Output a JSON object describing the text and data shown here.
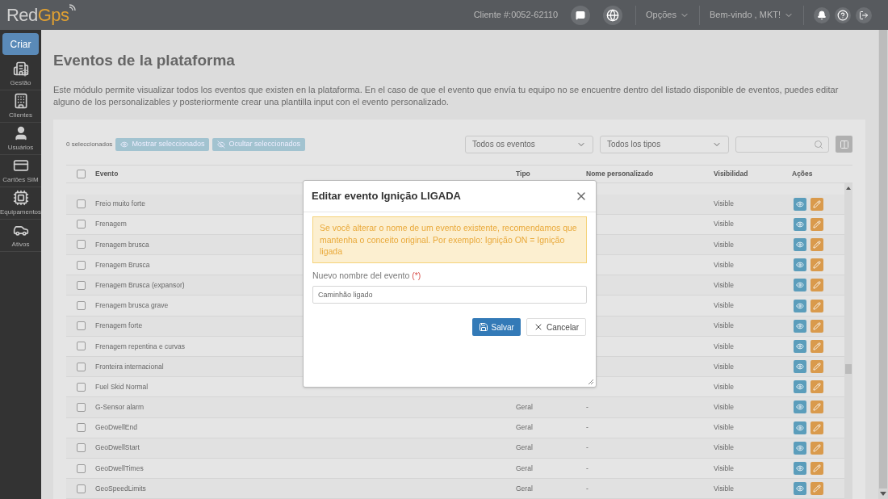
{
  "topbar": {
    "logo": {
      "first": "Red",
      "second": "Gps"
    },
    "client": "Cliente #:0052-62110",
    "options_menu": "Opções",
    "welcome_menu": "Bem-vindo , MKT!"
  },
  "sidebar": {
    "create_button": "Criar",
    "items": [
      {
        "kind": "gestao",
        "label": "Gestão"
      },
      {
        "kind": "clientes",
        "label": "Clientes"
      },
      {
        "kind": "usuarios",
        "label": "Usuários"
      },
      {
        "kind": "sim",
        "label": "Cartões SIM"
      },
      {
        "kind": "equip",
        "label": "Equipamentos"
      },
      {
        "kind": "ativos",
        "label": "Ativos"
      }
    ]
  },
  "page": {
    "title": "Eventos de la plataforma",
    "description": "Este módulo permite visualizar todos los eventos que existen en la plataforma. En el caso de que el evento que envía tu equipo no se encuentre dentro del listado disponible de eventos, puedes editar alguno de los personalizables y posteriormente crear una plantilla input con el evento personalizado."
  },
  "toolbar": {
    "selected_count": "0 seleccionados",
    "show_button": "Mostrar seleccionados",
    "hide_button": "Ocultar seleccionados",
    "event_filter": "Todos os eventos",
    "type_filter": "Todos los tipos"
  },
  "table": {
    "select_all": {
      "checked": false
    },
    "columns": [
      "Evento",
      "Tipo",
      "Nome personalizado",
      "Visibilidad",
      "Ações"
    ],
    "rows": [
      {
        "checked": false,
        "event": "Freio muito forte",
        "visibility": "Visible"
      },
      {
        "checked": false,
        "event": "Frenagem",
        "visibility": "Visible"
      },
      {
        "checked": false,
        "event": "Frenagem brusca",
        "visibility": "Visible"
      },
      {
        "checked": false,
        "event": "Frenagem Brusca",
        "visibility": "Visible"
      },
      {
        "checked": false,
        "event": "Frenagem Brusca (expansor)",
        "visibility": "Visible"
      },
      {
        "checked": false,
        "event": "Frenagem brusca grave",
        "visibility": "Visible"
      },
      {
        "checked": false,
        "event": "Frenagem forte",
        "visibility": "Visible"
      },
      {
        "checked": false,
        "event": "Frenagem repentina e curvas",
        "visibility": "Visible"
      },
      {
        "checked": false,
        "event": "Fronteira internacional",
        "visibility": "Visible"
      },
      {
        "checked": false,
        "event": "Fuel Skid Normal",
        "visibility": "Visible"
      },
      {
        "checked": false,
        "event": "G-Sensor alarm",
        "type": "Geral",
        "custom_name": "-",
        "visibility": "Visible"
      },
      {
        "checked": false,
        "event": "GeoDwellEnd",
        "type": "Geral",
        "custom_name": "-",
        "visibility": "Visible"
      },
      {
        "checked": false,
        "event": "GeoDwellStart",
        "type": "Geral",
        "custom_name": "-",
        "visibility": "Visible"
      },
      {
        "checked": false,
        "event": "GeoDwellTimes",
        "type": "Geral",
        "custom_name": "-",
        "visibility": "Visible"
      },
      {
        "checked": false,
        "event": "GeoSpeedLimits",
        "type": "Geral",
        "custom_name": "-",
        "visibility": "Visible"
      }
    ]
  },
  "modal": {
    "title": "Editar evento Ignição LIGADA",
    "warning": "Se você alterar o nome de um evento existente, recomendamos que mantenha o conceito original. Por exemplo: Ignição ON = Ignição ligada",
    "field_label": "Nuevo nombre del evento",
    "required_mark": "(*)",
    "field_placeholder": "Caminhão ligado",
    "save_button": "Salvar",
    "cancel_button": "Cancelar"
  }
}
